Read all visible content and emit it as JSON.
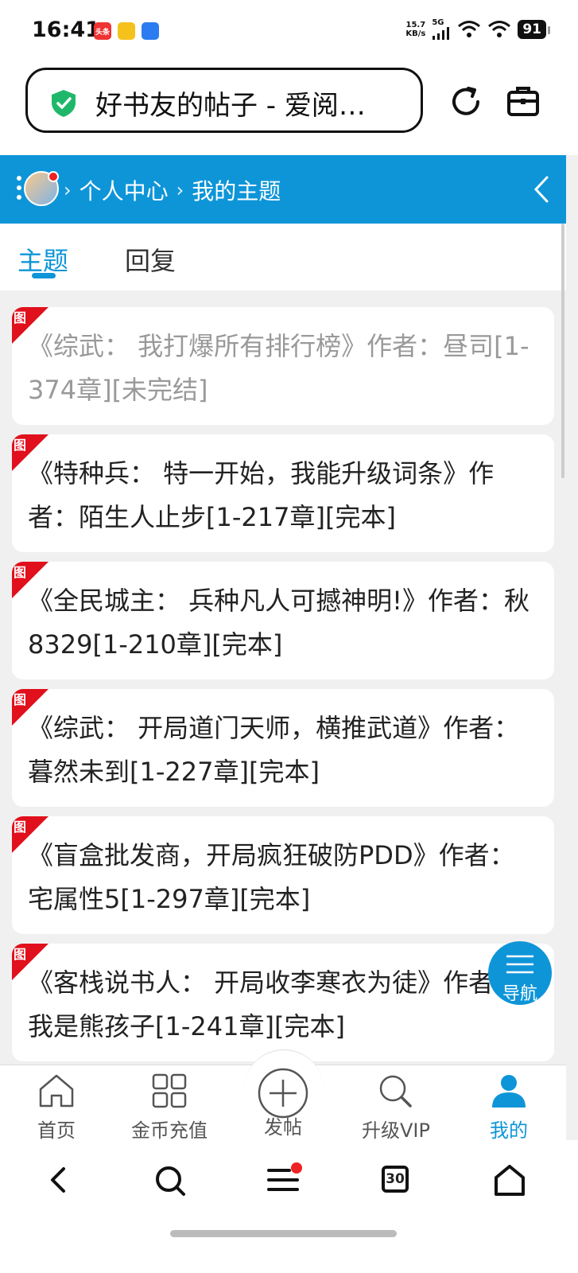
{
  "status_bar": {
    "time": "16:41",
    "net_speed_value": "15.7",
    "net_speed_unit": "KB/s",
    "network": "5G",
    "battery": "91",
    "app_badge": "头条"
  },
  "browser": {
    "url_title": "好书友的帖子 - 爱阅…"
  },
  "breadcrumb": {
    "items": [
      "个人中心",
      "我的主题"
    ]
  },
  "tabs": [
    {
      "label": "主题",
      "active": true
    },
    {
      "label": "回复",
      "active": false
    }
  ],
  "thread_flag": "图",
  "threads": [
    {
      "text": "《综武： 我打爆所有排行榜》作者：昼司[1-374章][未完结]",
      "read": true
    },
    {
      "text": "《特种兵： 特一开始，我能升级词条》作者：陌生人止步[1-217章][完本]",
      "read": false
    },
    {
      "text": "《全民城主： 兵种凡人可撼神明!》作者：秋8329[1-210章][完本]",
      "read": false
    },
    {
      "text": "《综武： 开局道门天师，横推武道》作者：暮然未到[1-227章][完本]",
      "read": false
    },
    {
      "text": "《盲盒批发商，开局疯狂破防PDD》作者：宅属性5[1-297章][完本]",
      "read": false
    },
    {
      "text": "《客栈说书人： 开局收李寒衣为徒》作者：我是熊孩子[1-241章][完本]",
      "read": false
    }
  ],
  "fab": {
    "label": "导航"
  },
  "bottom_nav": [
    {
      "label": "首页",
      "icon": "home-icon"
    },
    {
      "label": "金币充值",
      "icon": "grid-icon"
    },
    {
      "label": "发帖",
      "icon": "plus-circle-icon"
    },
    {
      "label": "升级VIP",
      "icon": "search-icon"
    },
    {
      "label": "我的",
      "icon": "user-icon",
      "active": true
    }
  ],
  "browser_bar": {
    "tabs_count": "30"
  },
  "colors": {
    "accent": "#0e95d8",
    "flag": "#e0101c"
  }
}
